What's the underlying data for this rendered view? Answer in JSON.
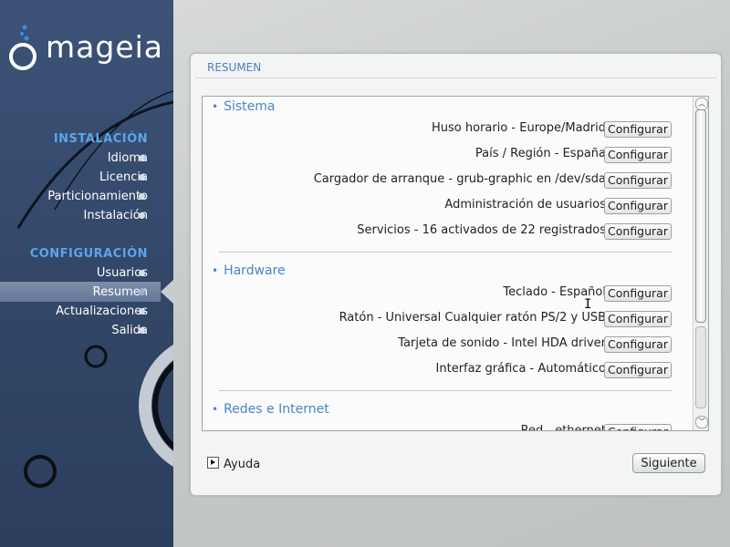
{
  "brand": {
    "name": "mageia"
  },
  "sidebar": {
    "sections": [
      {
        "title": "INSTALACIÓN",
        "items": [
          {
            "label": "Idioma"
          },
          {
            "label": "Licencia"
          },
          {
            "label": "Particionamiento"
          },
          {
            "label": "Instalación"
          }
        ]
      },
      {
        "title": "CONFIGURACIÓN",
        "items": [
          {
            "label": "Usuarios"
          },
          {
            "label": "Resumen",
            "active": true
          },
          {
            "label": "Actualizaciones"
          },
          {
            "label": "Salida"
          }
        ]
      }
    ]
  },
  "panel": {
    "title": "RESUMEN",
    "button_label": "Configurar",
    "groups": [
      {
        "title": "Sistema",
        "rows": [
          {
            "label": "Huso horario - Europe/Madrid"
          },
          {
            "label": "País / Región - España"
          },
          {
            "label": "Cargador de arranque - grub-graphic en /dev/sda"
          },
          {
            "label": "Administración de usuarios"
          },
          {
            "label": "Servicios - 16 activados de 22 registrados"
          }
        ]
      },
      {
        "title": "Hardware",
        "rows": [
          {
            "label": "Teclado - Español"
          },
          {
            "label": "Ratón - Universal Cualquier ratón PS/2 y USB"
          },
          {
            "label": "Tarjeta de sonido - Intel HDA driver"
          },
          {
            "label": "Interfaz gráfica - Automático"
          }
        ]
      },
      {
        "title": "Redes e Internet",
        "rows": [
          {
            "label": "Red - ethernet"
          }
        ]
      }
    ]
  },
  "footer": {
    "help_label": "Ayuda",
    "next_label": "Siguiente"
  },
  "colors": {
    "accent": "#4a84c8",
    "sidebar_bg": "#324667",
    "section_title": "#5aa6ea"
  }
}
